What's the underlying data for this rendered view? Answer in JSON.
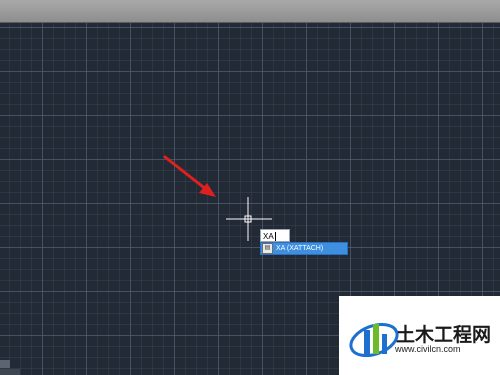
{
  "command_line": {
    "input_value": "XA",
    "suggestion": {
      "icon": "xref-attach-icon",
      "label": "XA (XATTACH)"
    }
  },
  "watermark": {
    "title": "土木工程网",
    "url": "www.civilcn.com"
  },
  "colors": {
    "canvas_background": "#222a35",
    "grid_major": "#5a687c",
    "suggestion_highlight": "#3e8fe0",
    "annotation_arrow": "#e02020",
    "logo_blue": "#1d6fd0",
    "logo_green": "#6cbb2a"
  }
}
